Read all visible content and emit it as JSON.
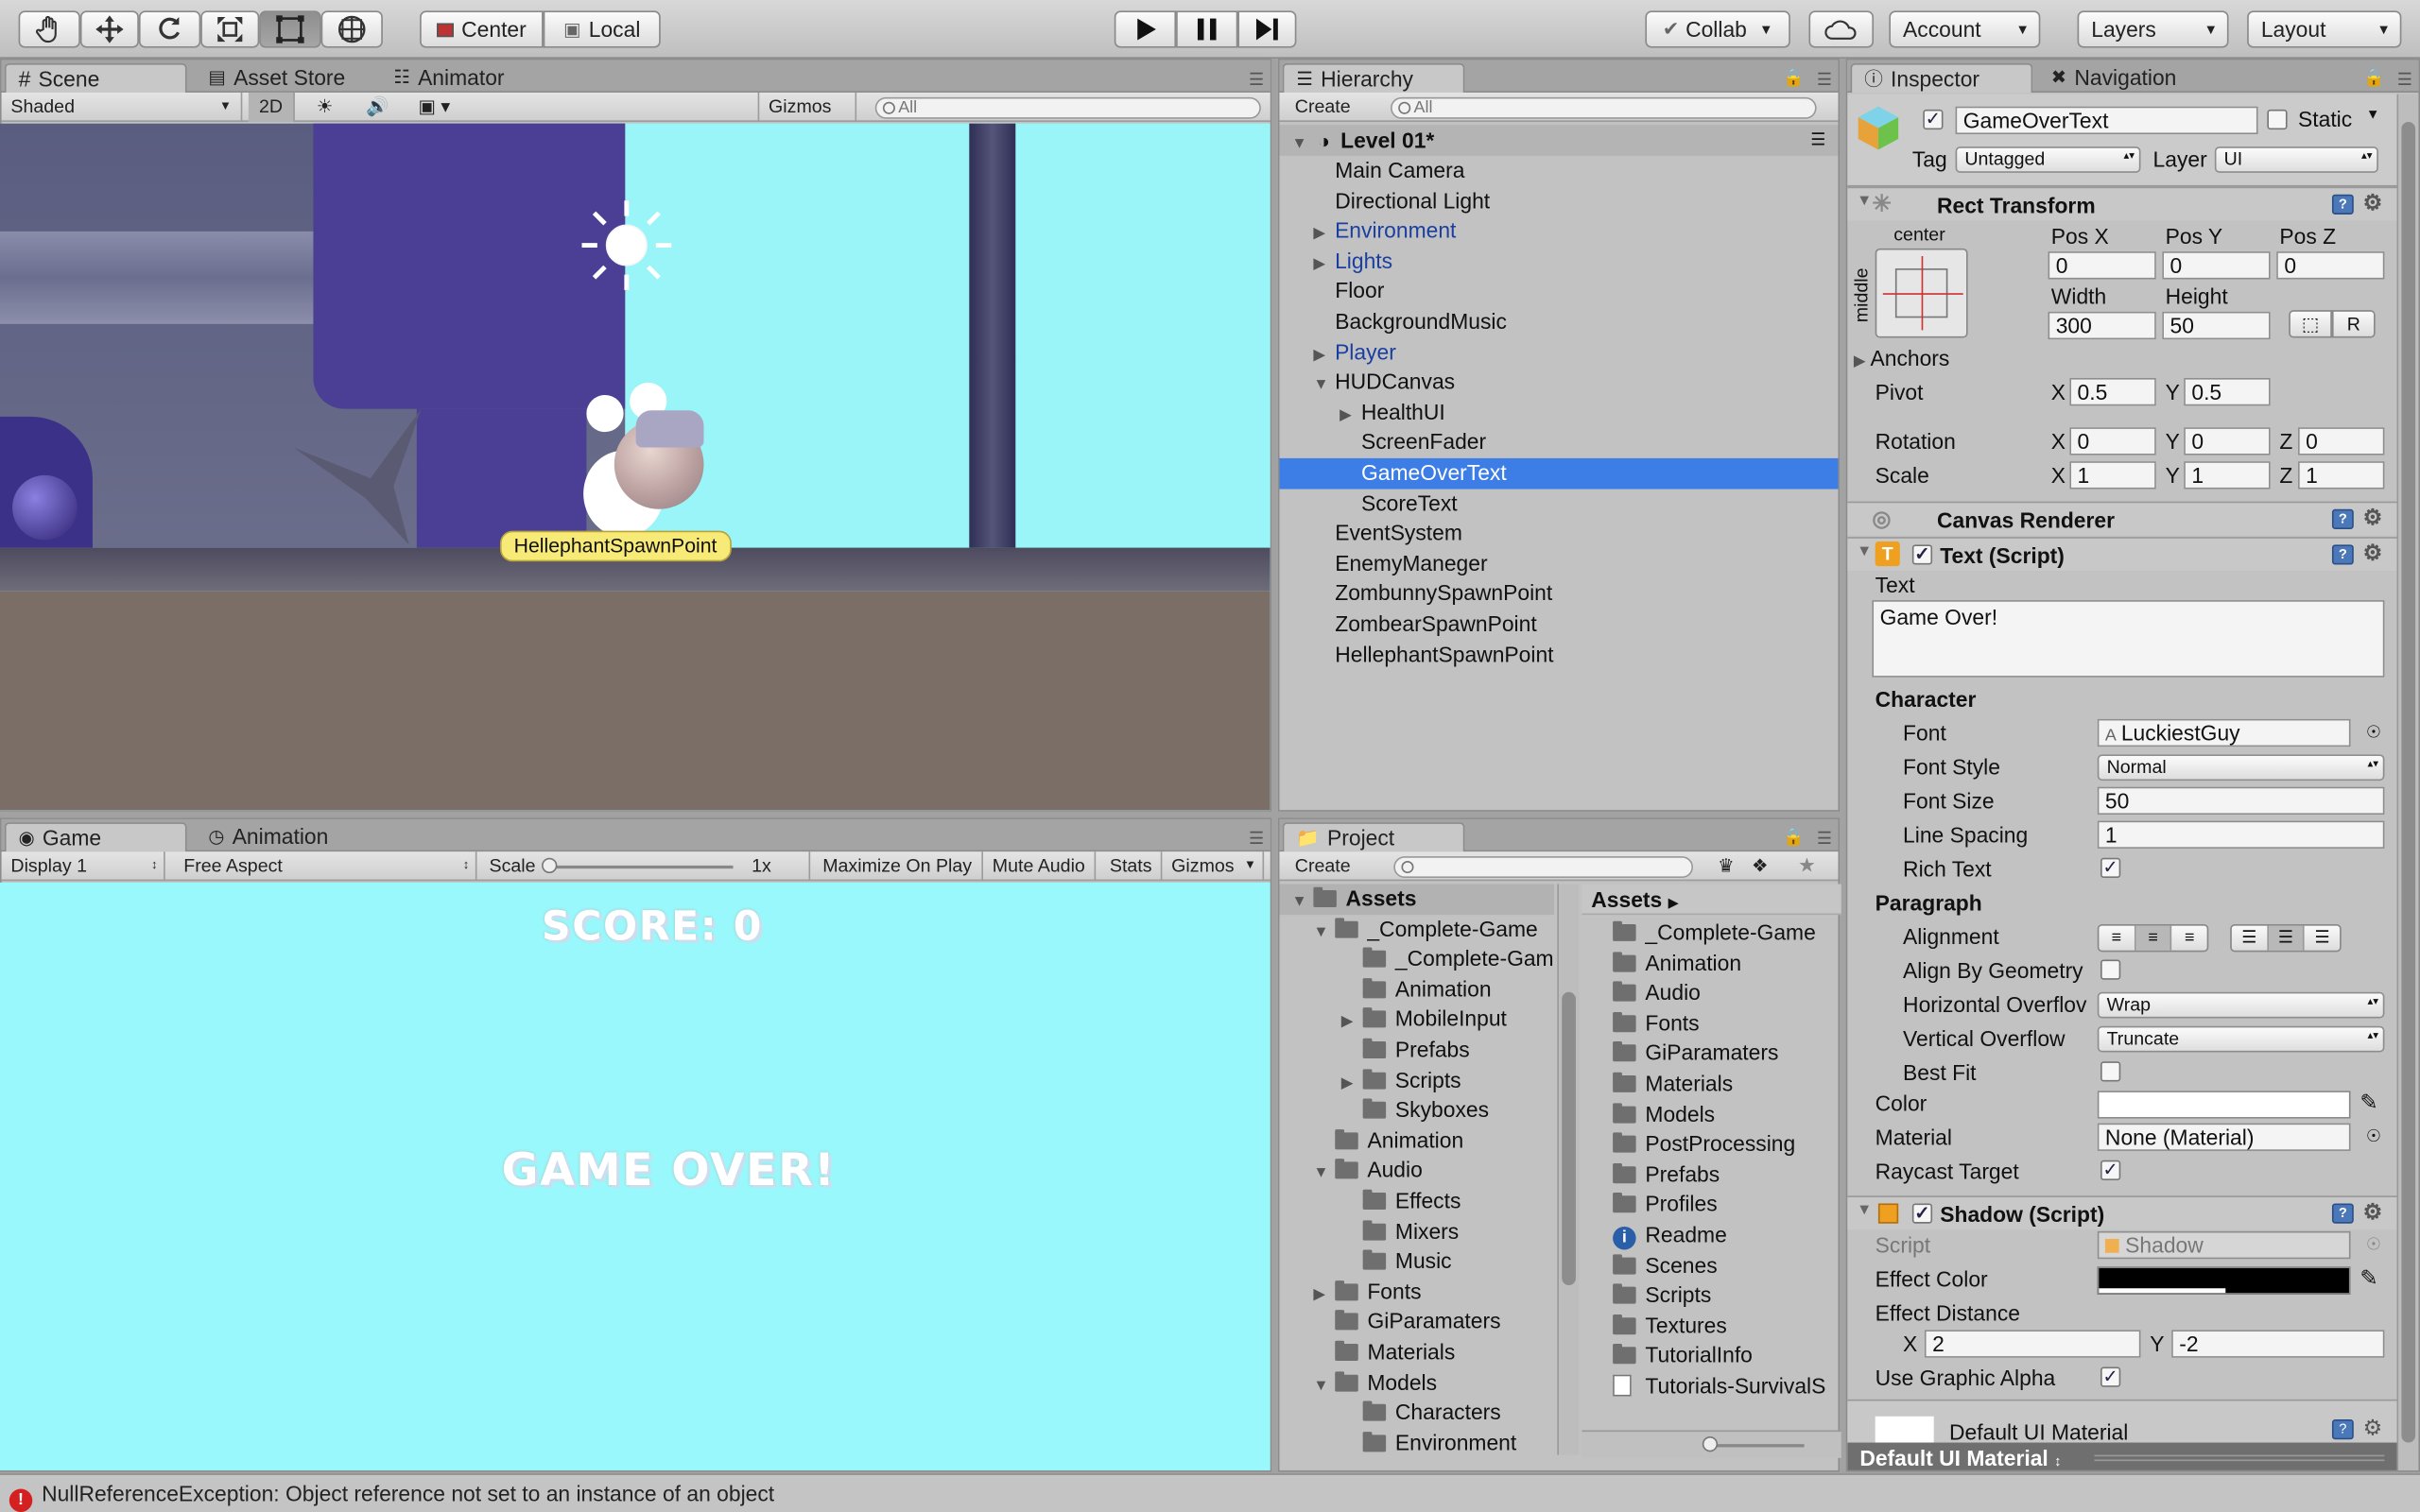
{
  "toolbar": {
    "tools": [
      "hand-tool-icon",
      "move-tool-icon",
      "rotate-tool-icon",
      "scale-tool-icon",
      "rect-tool-icon",
      "transform-tool-icon"
    ],
    "pivot_mode": "Center",
    "pivot_space": "Local",
    "collab": "Collab",
    "account": "Account",
    "layers": "Layers",
    "layout": "Layout"
  },
  "scene_panel": {
    "tabs": [
      "Scene",
      "Asset Store",
      "Animator"
    ],
    "shading": "Shaded",
    "mode_2d": "2D",
    "gizmos": "Gizmos",
    "search_placeholder": "All",
    "spawn_label": "HellephantSpawnPoint"
  },
  "game_panel": {
    "tabs": [
      "Game",
      "Animation"
    ],
    "display": "Display 1",
    "aspect": "Free Aspect",
    "scale_label": "Scale",
    "scale_value": "1x",
    "buttons": [
      "Maximize On Play",
      "Mute Audio",
      "Stats",
      "Gizmos"
    ],
    "score_text": "SCORE: 0",
    "gameover_text": "GAME OVER!"
  },
  "hierarchy": {
    "tab": "Hierarchy",
    "create": "Create",
    "search_placeholder": "All",
    "scene_name": "Level 01*",
    "items": [
      {
        "label": "Main Camera"
      },
      {
        "label": "Directional Light"
      },
      {
        "label": "Environment"
      },
      {
        "label": "Lights"
      },
      {
        "label": "Floor"
      },
      {
        "label": "BackgroundMusic"
      },
      {
        "label": "Player"
      },
      {
        "label": "HUDCanvas"
      },
      {
        "label": "HealthUI"
      },
      {
        "label": "ScreenFader"
      },
      {
        "label": "GameOverText"
      },
      {
        "label": "ScoreText"
      },
      {
        "label": "EventSystem"
      },
      {
        "label": "EnemyManeger"
      },
      {
        "label": "ZombunnySpawnPoint"
      },
      {
        "label": "ZombearSpawnPoint"
      },
      {
        "label": "HellephantSpawnPoint"
      }
    ]
  },
  "project": {
    "tab": "Project",
    "create": "Create",
    "tree": [
      {
        "label": "Assets"
      },
      {
        "label": "_Complete-Game"
      },
      {
        "label": "_Complete-Gam"
      },
      {
        "label": "Animation"
      },
      {
        "label": "MobileInput"
      },
      {
        "label": "Prefabs"
      },
      {
        "label": "Scripts"
      },
      {
        "label": "Skyboxes"
      },
      {
        "label": "Animation"
      },
      {
        "label": "Audio"
      },
      {
        "label": "Effects"
      },
      {
        "label": "Mixers"
      },
      {
        "label": "Music"
      },
      {
        "label": "Fonts"
      },
      {
        "label": "GiParamaters"
      },
      {
        "label": "Materials"
      },
      {
        "label": "Models"
      },
      {
        "label": "Characters"
      },
      {
        "label": "Environment"
      }
    ],
    "breadcrumb": "Assets",
    "assets": [
      {
        "label": "_Complete-Game"
      },
      {
        "label": "Animation"
      },
      {
        "label": "Audio"
      },
      {
        "label": "Fonts"
      },
      {
        "label": "GiParamaters"
      },
      {
        "label": "Materials"
      },
      {
        "label": "Models"
      },
      {
        "label": "PostProcessing"
      },
      {
        "label": "Prefabs"
      },
      {
        "label": "Profiles"
      },
      {
        "label": "Readme"
      },
      {
        "label": "Scenes"
      },
      {
        "label": "Scripts"
      },
      {
        "label": "Textures"
      },
      {
        "label": "TutorialInfo"
      },
      {
        "label": "Tutorials-SurvivalS"
      }
    ]
  },
  "inspector": {
    "tabs": [
      "Inspector",
      "Navigation"
    ],
    "object_name": "GameOverText",
    "static_label": "Static",
    "tag_label": "Tag",
    "tag_value": "Untagged",
    "layer_label": "Layer",
    "layer_value": "UI",
    "rect_transform": {
      "title": "Rect Transform",
      "anchor_h": "center",
      "anchor_v": "middle",
      "pos_x_label": "Pos X",
      "pos_y_label": "Pos Y",
      "pos_z_label": "Pos Z",
      "pos_x": "0",
      "pos_y": "0",
      "pos_z": "0",
      "width_label": "Width",
      "height_label": "Height",
      "width": "300",
      "height": "50",
      "r_button": "R",
      "anchors_label": "Anchors",
      "pivot_label": "Pivot",
      "pivot_x": "0.5",
      "pivot_y": "0.5",
      "rotation_label": "Rotation",
      "rot_x": "0",
      "rot_y": "0",
      "rot_z": "0",
      "scale_label": "Scale",
      "scale_x": "1",
      "scale_y": "1",
      "scale_z": "1",
      "x": "X",
      "y": "Y",
      "z": "Z"
    },
    "canvas_renderer": "Canvas Renderer",
    "text_script": {
      "title": "Text (Script)",
      "text_label": "Text",
      "text_value": "Game Over!",
      "character_label": "Character",
      "font_label": "Font",
      "font_value": "LuckiestGuy",
      "font_style_label": "Font Style",
      "font_style_value": "Normal",
      "font_size_label": "Font Size",
      "font_size_value": "50",
      "line_spacing_label": "Line Spacing",
      "line_spacing_value": "1",
      "rich_text_label": "Rich Text",
      "paragraph_label": "Paragraph",
      "alignment_label": "Alignment",
      "align_geom_label": "Align By Geometry",
      "h_overflow_label": "Horizontal Overflov",
      "h_overflow_value": "Wrap",
      "v_overflow_label": "Vertical Overflow",
      "v_overflow_value": "Truncate",
      "best_fit_label": "Best Fit",
      "color_label": "Color",
      "material_label": "Material",
      "material_value": "None (Material)",
      "raycast_label": "Raycast Target"
    },
    "shadow_script": {
      "title": "Shadow (Script)",
      "script_label": "Script",
      "script_value": "Shadow",
      "effect_color_label": "Effect Color",
      "effect_distance_label": "Effect Distance",
      "dist_x": "2",
      "dist_y": "-2",
      "use_alpha_label": "Use Graphic Alpha"
    },
    "default_material": "Default UI Material",
    "default_material_bar": "Default UI Material"
  },
  "status": {
    "message": "NullReferenceException: Object reference not set to an instance of an object"
  },
  "colors": {
    "selection": "#3d7ee6",
    "scene_sky": "#9af5f8",
    "game_bg": "#98f8fb",
    "prefab_blue": "#1a3fa0",
    "error_red": "#d42020"
  }
}
